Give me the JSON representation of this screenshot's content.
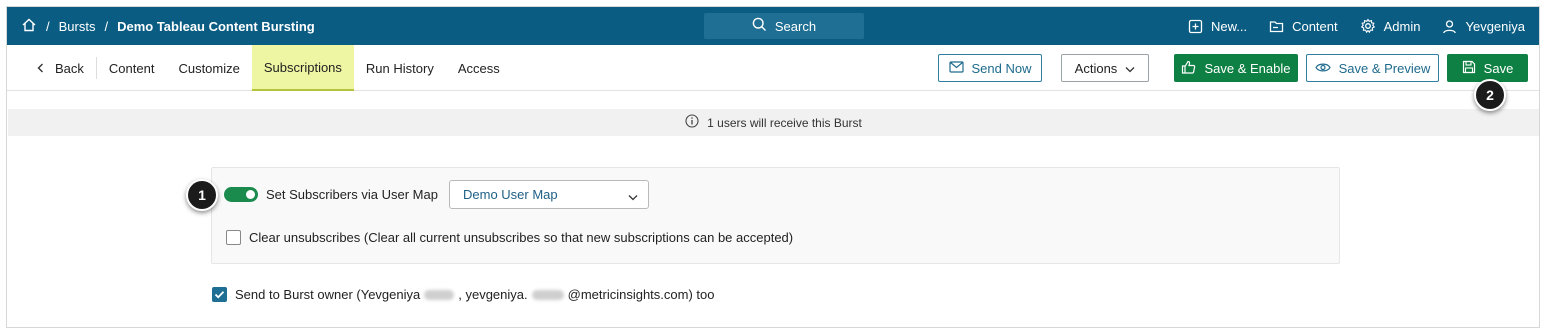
{
  "topbar": {
    "breadcrumb": {
      "sep": "/",
      "section": "Bursts",
      "current": "Demo Tableau Content Bursting"
    },
    "search_label": "Search",
    "menu": {
      "new_label": "New...",
      "content_label": "Content",
      "admin_label": "Admin",
      "user_label": "Yevgeniya"
    },
    "icons": [
      "home-icon",
      "search-icon",
      "plus-square-icon",
      "folder-icon",
      "gear-icon",
      "user-icon"
    ]
  },
  "tabs": {
    "back_label": "Back",
    "items": [
      {
        "label": "Content"
      },
      {
        "label": "Customize"
      },
      {
        "label": "Subscriptions",
        "active": true
      },
      {
        "label": "Run History"
      },
      {
        "label": "Access"
      }
    ]
  },
  "toolbar": {
    "send_now_label": "Send Now",
    "actions_label": "Actions",
    "save_enable_label": "Save & Enable",
    "save_preview_label": "Save & Preview",
    "save_label": "Save"
  },
  "info": {
    "text": "1 users will receive this Burst"
  },
  "subscribers": {
    "toggle_on": true,
    "usermap_label": "Set Subscribers via User Map",
    "usermap_selected": "Demo User Map",
    "clear_checked": false,
    "clear_label": "Clear unsubscribes (Clear all current unsubscribes so that new subscriptions can be accepted)"
  },
  "owner": {
    "checked": true,
    "prefix": "Send to Burst owner (Yevgeniya",
    "middle": ", yevgeniya.",
    "suffix": "@metricinsights.com) too"
  },
  "callouts": {
    "one": "1",
    "two": "2"
  },
  "colors": {
    "topbar": "#0a5c82",
    "green": "#0f8043",
    "active_tab": "#eef5a3",
    "link_blue": "#1e6a8d"
  }
}
